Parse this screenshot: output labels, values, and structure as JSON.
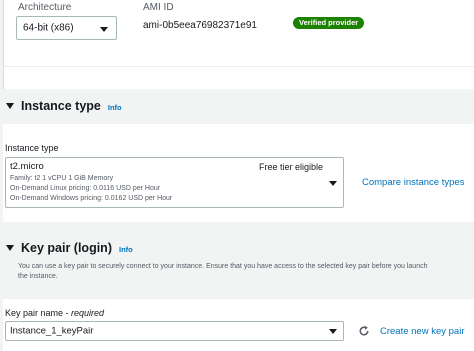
{
  "architecture": {
    "label": "Architecture",
    "value": "64-bit (x86)"
  },
  "ami": {
    "label": "AMI ID",
    "value": "ami-0b5eea76982371e91",
    "badge": "Verified provider",
    "badge_color": "#1d8102"
  },
  "instance_type_section": {
    "title": "Instance type",
    "info": "Info",
    "field_label": "Instance type",
    "selected": {
      "name": "t2.micro",
      "tier": "Free tier eligible",
      "specs": "Family: t2    1 vCPU    1 GiB Memory",
      "linux_pricing": "On-Demand Linux pricing: 0.0116 USD per Hour",
      "windows_pricing": "On-Demand Windows pricing: 0.0162 USD per Hour"
    },
    "compare_link": "Compare instance types"
  },
  "key_pair_section": {
    "title": "Key pair (login)",
    "info": "Info",
    "description_line1": "You can use a key pair to securely connect to your instance. Ensure that you have access to the selected key pair before you launch",
    "description_line2": "the instance.",
    "field_label": "Key pair name - ",
    "field_label_required": "required",
    "value": "Instance_1_keyPair",
    "create_link": "Create new key pair"
  },
  "colors": {
    "link": "#0073bb",
    "text": "#16191f",
    "muted": "#545b64"
  }
}
